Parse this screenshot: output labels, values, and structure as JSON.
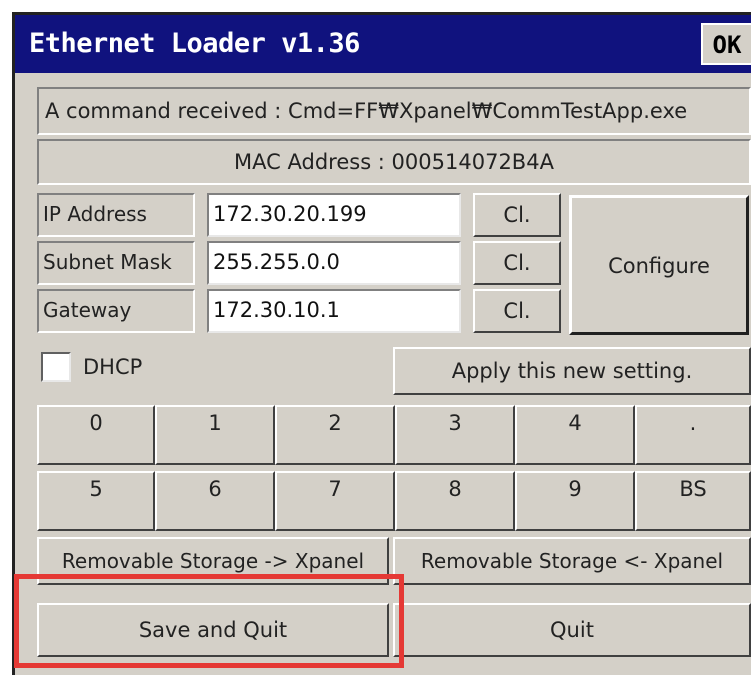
{
  "window": {
    "title": "Ethernet Loader v1.36",
    "ok_label": "OK",
    "title_bar_color": "#10127e",
    "face_color": "#d4d0c8"
  },
  "status": {
    "command_text": "A command received : Cmd=FF₩Xpanel₩CommTestApp.exe",
    "mac_text": "MAC Address : 000514072B4A"
  },
  "network": {
    "ip": {
      "label": "IP Address",
      "value": "172.30.20.199",
      "clear_label": "Cl."
    },
    "subnet": {
      "label": "Subnet Mask",
      "value": "255.255.0.0",
      "clear_label": "Cl."
    },
    "gateway": {
      "label": "Gateway",
      "value": "172.30.10.1",
      "clear_label": "Cl."
    },
    "configure_label": "Configure"
  },
  "dhcp": {
    "label": "DHCP",
    "checked": false
  },
  "apply_label": "Apply this new setting.",
  "keypad": {
    "row1": [
      "0",
      "1",
      "2",
      "3",
      "4",
      "."
    ],
    "row2": [
      "5",
      "6",
      "7",
      "8",
      "9",
      "BS"
    ]
  },
  "storage": {
    "to_xpanel": "Removable Storage -> Xpanel",
    "from_xpanel": "Removable Storage <- Xpanel"
  },
  "actions": {
    "save_quit": "Save and Quit",
    "quit": "Quit"
  },
  "highlight_color": "#e53935"
}
